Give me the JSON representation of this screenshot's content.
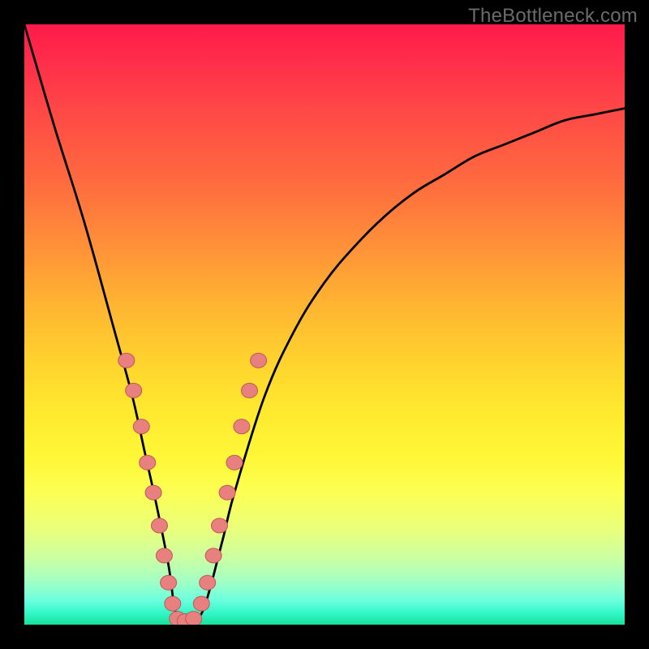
{
  "watermark": "TheBottleneck.com",
  "chart_data": {
    "type": "line",
    "title": "",
    "xlabel": "",
    "ylabel": "",
    "xlim": [
      0,
      100
    ],
    "ylim": [
      0,
      100
    ],
    "grid": false,
    "legend": false,
    "annotations": [],
    "series": [
      {
        "name": "bottleneck-curve",
        "x": [
          0,
          5,
          10,
          15,
          18,
          20,
          22,
          24,
          25,
          26,
          28,
          30,
          33,
          35,
          40,
          45,
          50,
          55,
          60,
          65,
          70,
          75,
          80,
          85,
          90,
          95,
          100
        ],
        "values": [
          100,
          83,
          67,
          49,
          38,
          29,
          20,
          10,
          3,
          0.5,
          0.5,
          3,
          14,
          22,
          38,
          49,
          57,
          63,
          68,
          72,
          75,
          78,
          80,
          82,
          84,
          85,
          86
        ]
      }
    ],
    "markers": [
      {
        "x": 17.0,
        "y": 44.0
      },
      {
        "x": 18.2,
        "y": 39.0
      },
      {
        "x": 19.5,
        "y": 33.0
      },
      {
        "x": 20.5,
        "y": 27.0
      },
      {
        "x": 21.5,
        "y": 22.0
      },
      {
        "x": 22.5,
        "y": 16.5
      },
      {
        "x": 23.3,
        "y": 11.5
      },
      {
        "x": 24.0,
        "y": 7.0
      },
      {
        "x": 24.7,
        "y": 3.5
      },
      {
        "x": 25.5,
        "y": 1.0
      },
      {
        "x": 26.8,
        "y": 0.6
      },
      {
        "x": 28.2,
        "y": 1.0
      },
      {
        "x": 29.5,
        "y": 3.5
      },
      {
        "x": 30.5,
        "y": 7.0
      },
      {
        "x": 31.5,
        "y": 11.5
      },
      {
        "x": 32.5,
        "y": 16.5
      },
      {
        "x": 33.8,
        "y": 22.0
      },
      {
        "x": 35.0,
        "y": 27.0
      },
      {
        "x": 36.2,
        "y": 33.0
      },
      {
        "x": 37.5,
        "y": 39.0
      },
      {
        "x": 39.0,
        "y": 44.0
      }
    ],
    "colors": {
      "curve": "#000000",
      "marker_fill": "#e98080",
      "marker_stroke": "#c05858"
    }
  }
}
